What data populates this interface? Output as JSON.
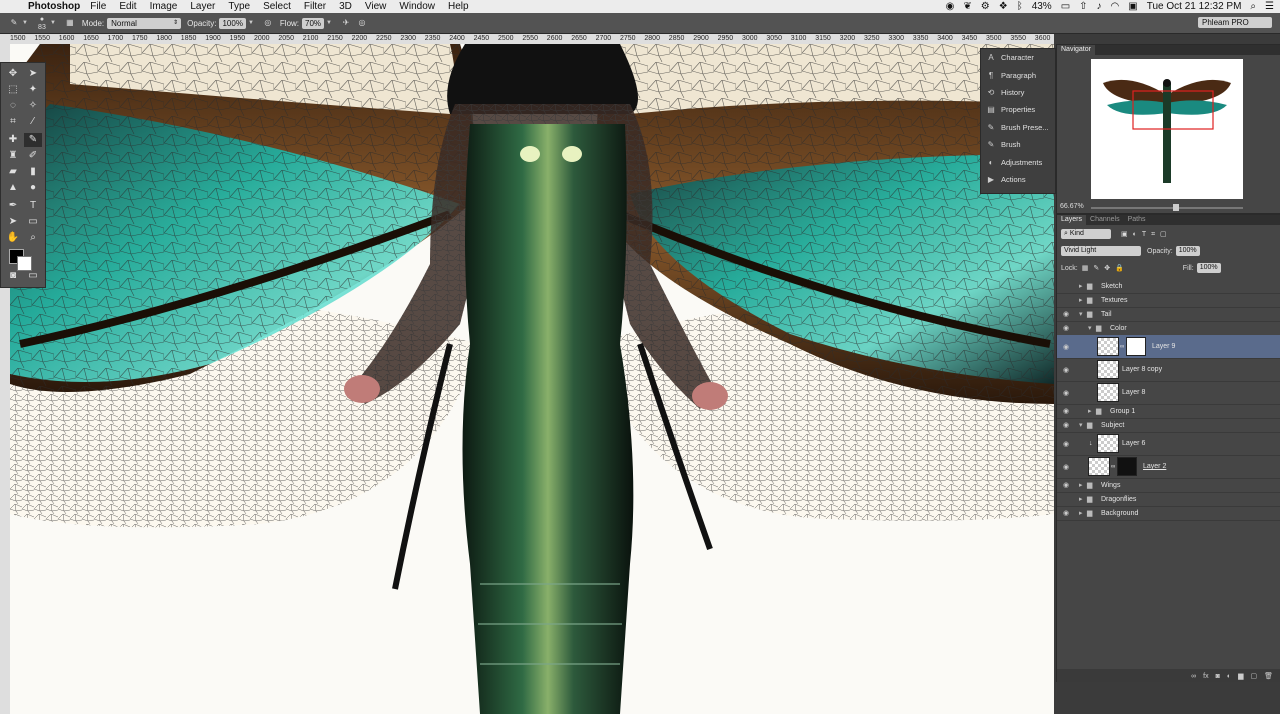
{
  "menubar": {
    "app_name": "Photoshop",
    "items": [
      "File",
      "Edit",
      "Image",
      "Layer",
      "Type",
      "Select",
      "Filter",
      "3D",
      "View",
      "Window",
      "Help"
    ],
    "battery": "43%",
    "clock": "Tue Oct 21  12:32 PM"
  },
  "options": {
    "brush_size": "83",
    "mode_label": "Mode:",
    "mode_value": "Normal",
    "opacity_label": "Opacity:",
    "opacity_value": "100%",
    "flow_label": "Flow:",
    "flow_value": "70%",
    "workspace": "Phleam PRO"
  },
  "ruler": {
    "ticks": [
      "1500",
      "1550",
      "1600",
      "1650",
      "1700",
      "1750",
      "1800",
      "1850",
      "1900",
      "1950",
      "2000",
      "2050",
      "2100",
      "2150",
      "2200",
      "2250",
      "2300",
      "2350",
      "2400",
      "2450",
      "2500",
      "2550",
      "2600",
      "2650",
      "2700",
      "2750",
      "2800",
      "2850",
      "2900",
      "2950",
      "3000",
      "3050",
      "3100",
      "3150",
      "3200",
      "3250",
      "3300",
      "3350",
      "3400",
      "3450",
      "3500",
      "3550",
      "3600",
      "3650",
      "3700",
      "3750",
      "3800"
    ]
  },
  "dock": {
    "items": [
      {
        "label": "Character",
        "icon": "A"
      },
      {
        "label": "Paragraph",
        "icon": "¶"
      },
      {
        "label": "History",
        "icon": "⟲"
      },
      {
        "label": "Properties",
        "icon": "▤"
      },
      {
        "label": "Brush Prese...",
        "icon": "✎"
      },
      {
        "label": "Brush",
        "icon": "✎"
      },
      {
        "label": "Adjustments",
        "icon": "◐"
      },
      {
        "label": "Actions",
        "icon": "▶"
      }
    ]
  },
  "navigator": {
    "title": "Navigator",
    "zoom": "66.67%"
  },
  "layers": {
    "tabs": [
      "Layers",
      "Channels",
      "Paths"
    ],
    "kind_label": "Kind",
    "blend_mode": "Vivid Light",
    "opacity_label": "Opacity:",
    "opacity_value": "100%",
    "lock_label": "Lock:",
    "fill_label": "Fill:",
    "fill_value": "100%",
    "items": [
      {
        "name": "Sketch",
        "type": "group",
        "indent": 0,
        "visible": false,
        "selected": false
      },
      {
        "name": "Textures",
        "type": "group",
        "indent": 0,
        "visible": false,
        "selected": false
      },
      {
        "name": "Tail",
        "type": "group",
        "indent": 0,
        "visible": true,
        "selected": false,
        "open": true
      },
      {
        "name": "Color",
        "type": "group",
        "indent": 1,
        "visible": true,
        "selected": false,
        "open": true
      },
      {
        "name": "Layer 9",
        "type": "layer-mask",
        "indent": 2,
        "visible": true,
        "selected": true
      },
      {
        "name": "Layer 8 copy",
        "type": "layer",
        "indent": 2,
        "visible": true,
        "selected": false
      },
      {
        "name": "Layer 8",
        "type": "layer",
        "indent": 2,
        "visible": true,
        "selected": false
      },
      {
        "name": "Group 1",
        "type": "group",
        "indent": 1,
        "visible": true,
        "selected": false
      },
      {
        "name": "Subject",
        "type": "group",
        "indent": 0,
        "visible": true,
        "selected": false,
        "open": true
      },
      {
        "name": "Layer 6",
        "type": "layer",
        "indent": 1,
        "visible": true,
        "selected": false
      },
      {
        "name": "Layer 2",
        "type": "layer-mask",
        "indent": 1,
        "visible": true,
        "selected": false
      },
      {
        "name": "Wings",
        "type": "group",
        "indent": 0,
        "visible": true,
        "selected": false
      },
      {
        "name": "Dragonflies",
        "type": "group",
        "indent": 0,
        "visible": false,
        "selected": false
      },
      {
        "name": "Background",
        "type": "group",
        "indent": 0,
        "visible": true,
        "selected": false
      }
    ]
  },
  "colors": {
    "selection": "#5a6b8c",
    "panel": "#464646",
    "wing_teal": "#1fb7a8",
    "wing_brown": "#6a3d1c"
  }
}
